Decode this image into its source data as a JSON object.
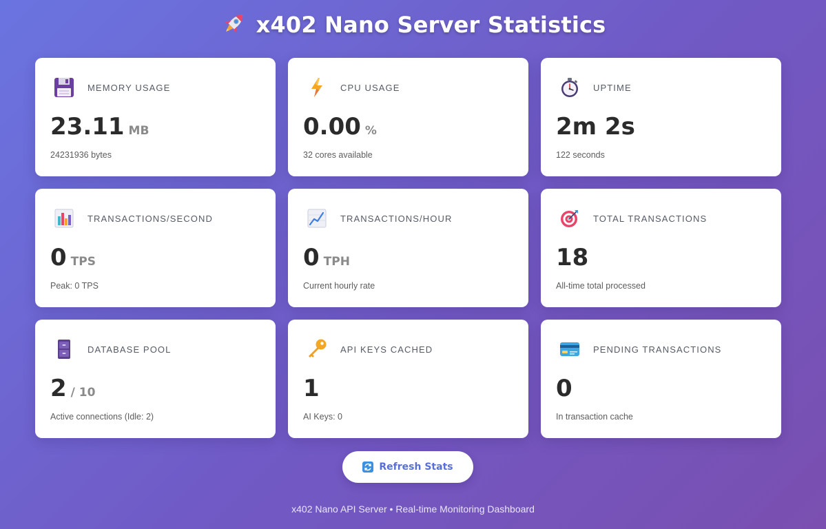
{
  "header": {
    "title": "x402 Nano Server Statistics",
    "icon": "rocket-icon"
  },
  "cards": [
    {
      "label": "MEMORY USAGE",
      "icon": "floppy-disk-icon",
      "value": "23.11",
      "unit": "MB",
      "sub": "24231936 bytes"
    },
    {
      "label": "CPU USAGE",
      "icon": "lightning-icon",
      "value": "0.00",
      "unit": "%",
      "sub": "32 cores available"
    },
    {
      "label": "UPTIME",
      "icon": "stopwatch-icon",
      "value": "2m 2s",
      "unit": "",
      "sub": "122 seconds"
    },
    {
      "label": "TRANSACTIONS/SECOND",
      "icon": "bar-chart-icon",
      "value": "0",
      "unit": "TPS",
      "sub": "Peak: 0 TPS"
    },
    {
      "label": "TRANSACTIONS/HOUR",
      "icon": "line-chart-icon",
      "value": "0",
      "unit": "TPH",
      "sub": "Current hourly rate"
    },
    {
      "label": "TOTAL TRANSACTIONS",
      "icon": "target-icon",
      "value": "18",
      "unit": "",
      "sub": "All-time total processed"
    },
    {
      "label": "DATABASE POOL",
      "icon": "file-cabinet-icon",
      "value": "2",
      "unit": "/ 10",
      "sub": "Active connections (Idle: 2)"
    },
    {
      "label": "API KEYS CACHED",
      "icon": "key-icon",
      "value": "1",
      "unit": "",
      "sub": "AI Keys: 0"
    },
    {
      "label": "PENDING TRANSACTIONS",
      "icon": "credit-card-icon",
      "value": "0",
      "unit": "",
      "sub": "In transaction cache"
    }
  ],
  "refresh_button": {
    "label": "Refresh Stats",
    "icon": "refresh-icon"
  },
  "footer": {
    "text": "x402 Nano API Server • Real-time Monitoring Dashboard"
  },
  "colors": {
    "background_start": "#6a74e0",
    "background_end": "#7a4fb0",
    "card": "#ffffff",
    "button_text": "#5a6fd6"
  }
}
